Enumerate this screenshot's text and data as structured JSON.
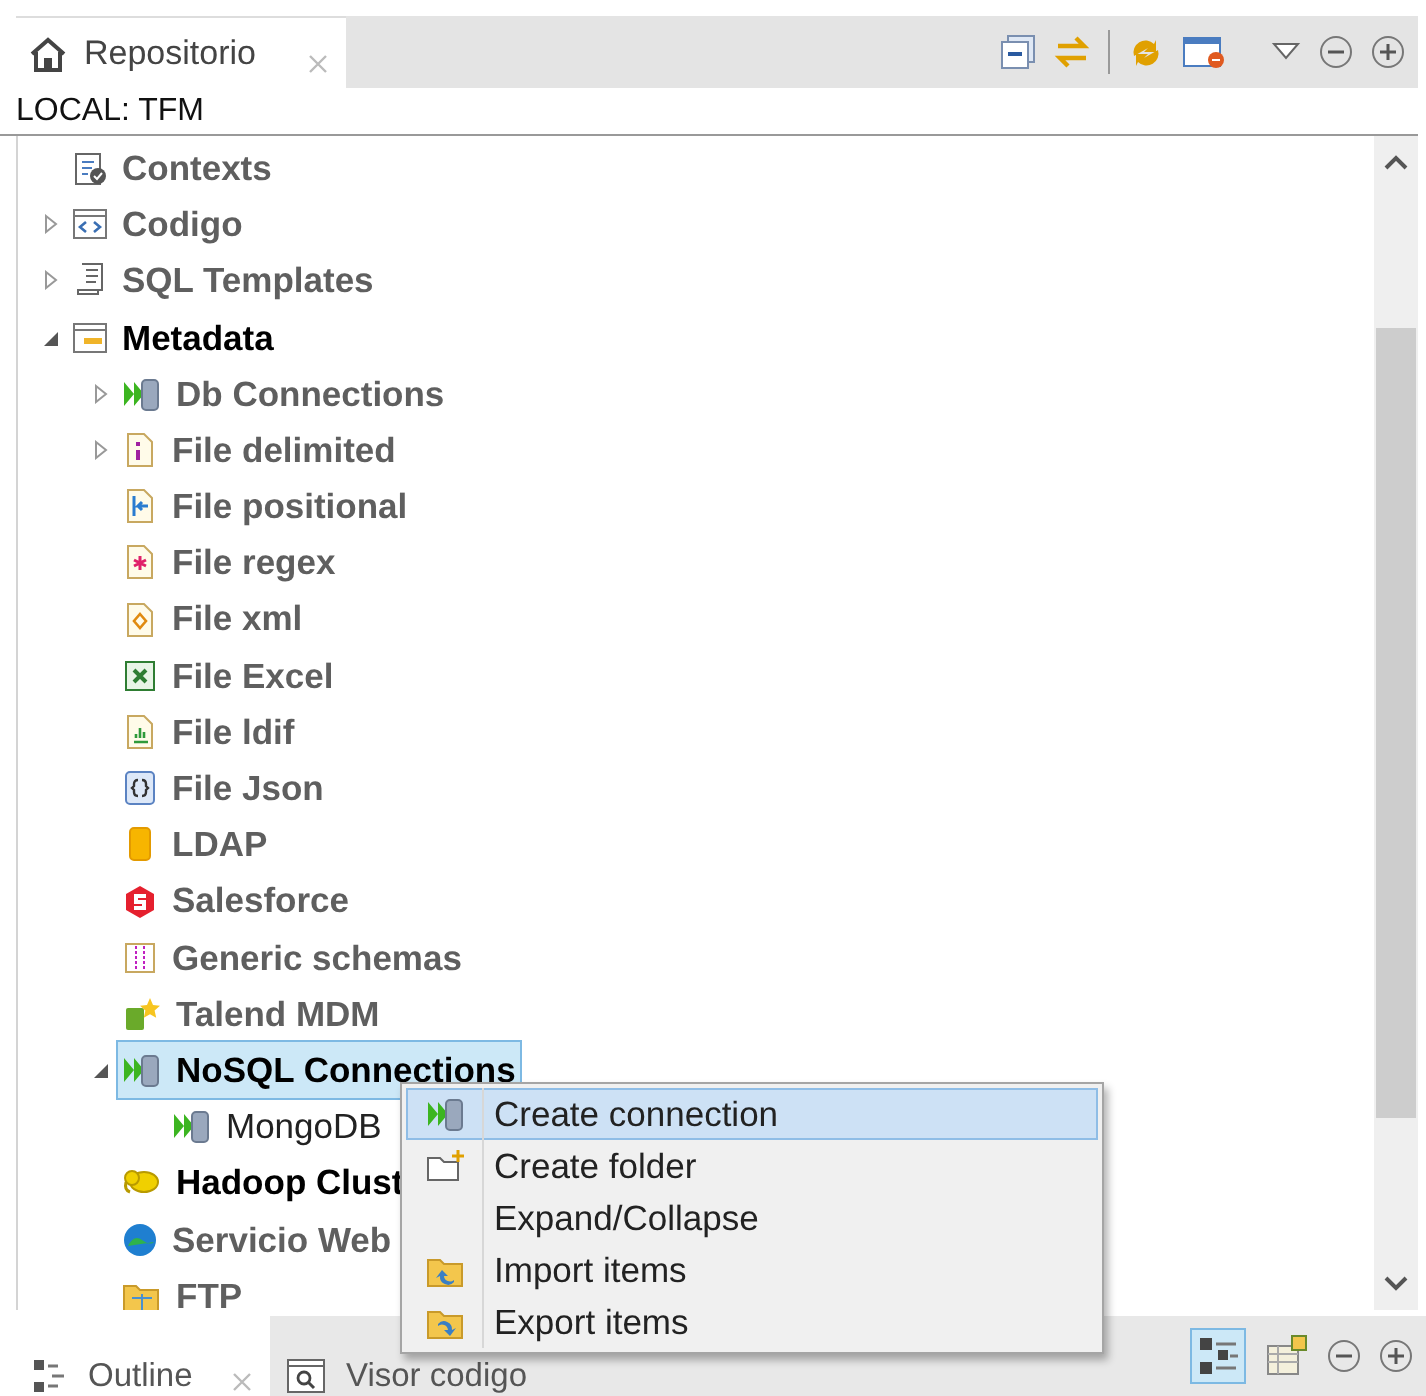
{
  "view_tab": {
    "label": "Repositorio",
    "selected": true
  },
  "path": "LOCAL: TFM",
  "tree": [
    {
      "label": "Contexts",
      "selected": false,
      "emphasized": false
    },
    {
      "label": "Codigo",
      "selected": false,
      "emphasized": false,
      "expanded": false
    },
    {
      "label": "SQL Templates",
      "selected": false,
      "emphasized": false,
      "expanded": false
    },
    {
      "label": "Metadata",
      "selected": false,
      "emphasized": true,
      "expanded": true,
      "children": [
        {
          "label": "Db Connections",
          "selected": false,
          "emphasized": false,
          "expanded": false
        },
        {
          "label": "File delimited",
          "selected": false,
          "emphasized": false,
          "expanded": false
        },
        {
          "label": "File positional",
          "selected": false,
          "emphasized": false
        },
        {
          "label": "File regex",
          "selected": false,
          "emphasized": false
        },
        {
          "label": "File xml",
          "selected": false,
          "emphasized": false
        },
        {
          "label": "File Excel",
          "selected": false,
          "emphasized": false
        },
        {
          "label": "File ldif",
          "selected": false,
          "emphasized": false
        },
        {
          "label": "File Json",
          "selected": false,
          "emphasized": false
        },
        {
          "label": "LDAP",
          "selected": false,
          "emphasized": false
        },
        {
          "label": "Salesforce",
          "selected": false,
          "emphasized": false
        },
        {
          "label": "Generic schemas",
          "selected": false,
          "emphasized": false
        },
        {
          "label": "Talend MDM",
          "selected": false,
          "emphasized": false
        },
        {
          "label": "NoSQL Connections",
          "selected": true,
          "emphasized": true,
          "expanded": true,
          "children": [
            {
              "label": "MongoDB",
              "selected": false,
              "plain": true
            }
          ]
        },
        {
          "label": "Hadoop Clust",
          "selected": false,
          "emphasized": true
        },
        {
          "label": "Servicio Web",
          "selected": false,
          "emphasized": false
        },
        {
          "label": "FTP",
          "selected": false,
          "emphasized": false
        }
      ]
    }
  ],
  "context_menu": {
    "items": [
      {
        "label": "Create connection",
        "selected": true
      },
      {
        "label": "Create folder",
        "selected": false
      },
      {
        "label": "Expand/Collapse",
        "selected": false
      },
      {
        "label": "Import items",
        "selected": false
      },
      {
        "label": "Export items",
        "selected": false
      }
    ]
  },
  "bottom_tabs": [
    {
      "label": "Outline",
      "selected": true
    },
    {
      "label": "Visor codigo",
      "selected": false
    }
  ]
}
